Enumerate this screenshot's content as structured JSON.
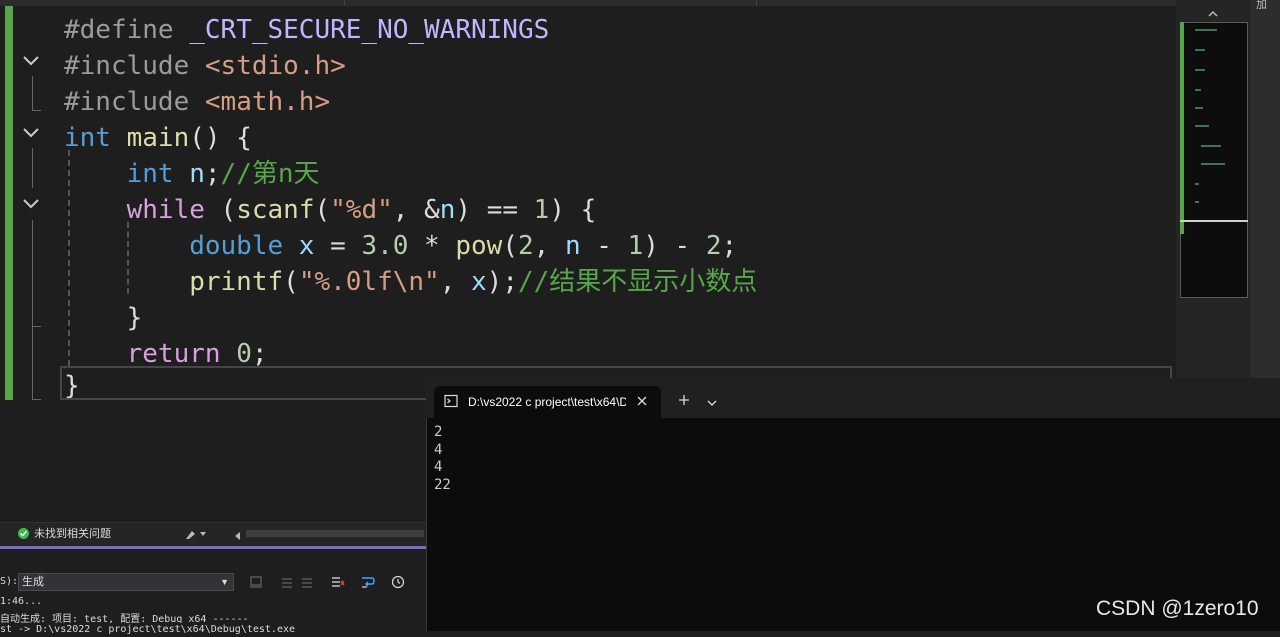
{
  "editor": {
    "lines": [
      {
        "tokens": [
          {
            "t": "#define",
            "c": "k-pre"
          },
          {
            "t": " _CRT_SECURE_NO_WARNINGS",
            "c": "k-macro"
          }
        ]
      },
      {
        "tokens": [
          {
            "t": "#include",
            "c": "k-pre"
          },
          {
            "t": " <stdio.h>",
            "c": "k-inc"
          }
        ]
      },
      {
        "tokens": [
          {
            "t": "#include",
            "c": "k-pre"
          },
          {
            "t": " <math.h>",
            "c": "k-inc"
          }
        ]
      },
      {
        "tokens": [
          {
            "t": "int",
            "c": "k-blue"
          },
          {
            "t": " main",
            "c": "k-fn"
          },
          {
            "t": "() {",
            "c": ""
          }
        ]
      },
      {
        "tokens": [
          {
            "t": "    int",
            "c": "k-blue"
          },
          {
            "t": " n",
            "c": "k-var"
          },
          {
            "t": ";",
            "c": ""
          },
          {
            "t": "//第n天",
            "c": "k-cmt"
          }
        ]
      },
      {
        "tokens": [
          {
            "t": "    while",
            "c": "k-purple"
          },
          {
            "t": " (",
            "c": ""
          },
          {
            "t": "scanf",
            "c": "k-fn"
          },
          {
            "t": "(",
            "c": ""
          },
          {
            "t": "\"%d\"",
            "c": "k-str"
          },
          {
            "t": ", &",
            "c": ""
          },
          {
            "t": "n",
            "c": "k-var"
          },
          {
            "t": ") == ",
            "c": ""
          },
          {
            "t": "1",
            "c": "k-num"
          },
          {
            "t": ") {",
            "c": ""
          }
        ]
      },
      {
        "tokens": [
          {
            "t": "        double",
            "c": "k-blue"
          },
          {
            "t": " x",
            "c": "k-var"
          },
          {
            "t": " = ",
            "c": ""
          },
          {
            "t": "3.0",
            "c": "k-num"
          },
          {
            "t": " * ",
            "c": ""
          },
          {
            "t": "pow",
            "c": "k-fn"
          },
          {
            "t": "(",
            "c": ""
          },
          {
            "t": "2",
            "c": "k-num"
          },
          {
            "t": ", ",
            "c": ""
          },
          {
            "t": "n",
            "c": "k-var"
          },
          {
            "t": " - ",
            "c": ""
          },
          {
            "t": "1",
            "c": "k-num"
          },
          {
            "t": ") - ",
            "c": ""
          },
          {
            "t": "2",
            "c": "k-num"
          },
          {
            "t": ";",
            "c": ""
          }
        ]
      },
      {
        "tokens": [
          {
            "t": "        printf",
            "c": "k-fn"
          },
          {
            "t": "(",
            "c": ""
          },
          {
            "t": "\"%.0lf\\n\"",
            "c": "k-str"
          },
          {
            "t": ", ",
            "c": ""
          },
          {
            "t": "x",
            "c": "k-var"
          },
          {
            "t": ");",
            "c": ""
          },
          {
            "t": "//结果不显示小数点",
            "c": "k-cmt"
          }
        ]
      },
      {
        "tokens": [
          {
            "t": "    }",
            "c": ""
          }
        ]
      },
      {
        "tokens": [
          {
            "t": "    return",
            "c": "k-purple"
          },
          {
            "t": " ",
            "c": ""
          },
          {
            "t": "0",
            "c": "k-num"
          },
          {
            "t": ";",
            "c": ""
          }
        ]
      },
      {
        "tokens": [
          {
            "t": "}",
            "c": ""
          }
        ]
      }
    ]
  },
  "status": {
    "issues_text": "未找到相关问题"
  },
  "output": {
    "source_label": "S):",
    "source_value": "生成",
    "log": [
      "1:46...",
      "自动生成: 项目: test, 配置: Debug x64 ------",
      "st -> D:\\vs2022 c project\\test\\x64\\Debug\\test.exe"
    ]
  },
  "terminal": {
    "tab_title": "D:\\vs2022 c project\\test\\x64\\D",
    "output_lines": [
      "2",
      "4",
      "4",
      "22"
    ]
  },
  "watermark": {
    "text": "CSDN @1zero10"
  },
  "right_edge": {
    "glyph": "加"
  }
}
